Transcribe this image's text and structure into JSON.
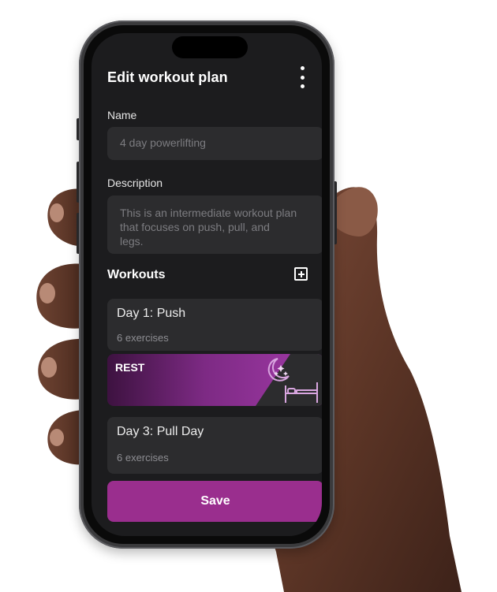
{
  "header": {
    "title": "Edit workout plan",
    "menu_icon": "more-vertical-icon"
  },
  "form": {
    "name_label": "Name",
    "name_value": "4 day powerlifting",
    "description_label": "Description",
    "description_value": "This is an intermediate workout plan\nthat focuses  on push, pull, and\nlegs."
  },
  "workouts": {
    "title": "Workouts",
    "add_icon": "plus-square-icon",
    "items": [
      {
        "title": "Day 1: Push",
        "subtitle": "6 exercises"
      },
      {
        "title": "REST",
        "icons": [
          "moon-stars-icon",
          "bed-icon"
        ]
      },
      {
        "title": "Day 3: Pull Day",
        "subtitle": "6 exercises"
      }
    ]
  },
  "actions": {
    "save_label": "Save"
  },
  "colors": {
    "accent": "#9a2e8e",
    "surface": "#2c2c2e",
    "background": "#1c1c1e",
    "rest_gradient": [
      "#3d1240",
      "#a23aa8"
    ]
  }
}
